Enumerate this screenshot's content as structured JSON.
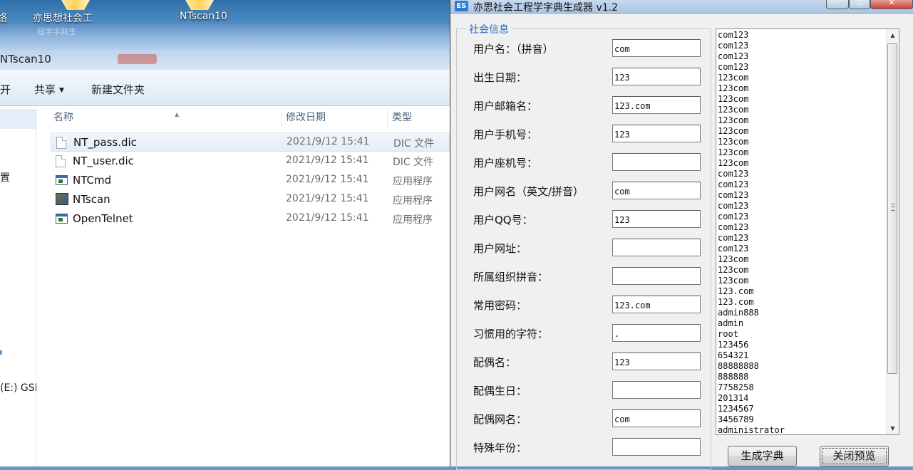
{
  "desktop": {
    "icons": [
      {
        "label": "络",
        "glyph": "partial-icon"
      },
      {
        "label": "亦思想社会工",
        "sub": "程学字典生",
        "glyph": "folder-icon"
      },
      {
        "label": "NTscan10",
        "glyph": "folder-icon"
      }
    ]
  },
  "explorer": {
    "address": "NTscan10",
    "toolbar": {
      "open": "开",
      "share": "共享",
      "new_folder": "新建文件夹"
    },
    "nav": {
      "item_settings": "置",
      "item_drive": "(E:) GSP"
    },
    "columns": {
      "name": "名称",
      "date": "修改日期",
      "type": "类型"
    },
    "files": [
      {
        "name": "NT_pass.dic",
        "date": "2021/9/12 15:41",
        "type": "DIC 文件",
        "icon": "document-icon"
      },
      {
        "name": "NT_user.dic",
        "date": "2021/9/12 15:41",
        "type": "DIC 文件",
        "icon": "document-icon"
      },
      {
        "name": "NTCmd",
        "date": "2021/9/12 15:41",
        "type": "应用程序",
        "icon": "application-icon"
      },
      {
        "name": "NTscan",
        "date": "2021/9/12 15:41",
        "type": "应用程序",
        "icon": "ntscan-app-icon"
      },
      {
        "name": "OpenTelnet",
        "date": "2021/9/12 15:41",
        "type": "应用程序",
        "icon": "application-icon"
      }
    ]
  },
  "generator": {
    "app_icon_text": "ES",
    "title": "亦思社会工程学字典生成器 v1.2",
    "group_title": "社会信息",
    "fields": [
      {
        "label": "用户名：（拼音）",
        "value": "com"
      },
      {
        "label": "出生日期：",
        "value": "123"
      },
      {
        "label": "用户邮箱名：",
        "value": "123.com"
      },
      {
        "label": "用户手机号：",
        "value": "123"
      },
      {
        "label": "用户座机号：",
        "value": ""
      },
      {
        "label": "用户网名（英文/拼音）",
        "value": "com"
      },
      {
        "label": "用户QQ号：",
        "value": "123"
      },
      {
        "label": "用户网址：",
        "value": ""
      },
      {
        "label": "所属组织拼音：",
        "value": ""
      },
      {
        "label": "常用密码：",
        "value": "123.com"
      },
      {
        "label": "习惯用的字符：",
        "value": "."
      },
      {
        "label": "配偶名：",
        "value": "123"
      },
      {
        "label": "配偶生日：",
        "value": ""
      },
      {
        "label": "配偶网名：",
        "value": "com"
      },
      {
        "label": "特殊年份：",
        "value": ""
      }
    ],
    "preview_lines": [
      "com123",
      "com123",
      "com123",
      "com123",
      "123com",
      "123com",
      "123com",
      "123com",
      "123com",
      "123com",
      "123com",
      "123com",
      "123com",
      "com123",
      "com123",
      "com123",
      "com123",
      "com123",
      "com123",
      "com123",
      "com123",
      "123com",
      "123com",
      "123com",
      "123.com",
      "123.com",
      "admin888",
      "admin",
      "root",
      "123456",
      "654321",
      "88888888",
      "888888",
      "7758258",
      "201314",
      "1234567",
      "3456789",
      "administrator"
    ],
    "buttons": {
      "generate": "生成字典",
      "close_preview": "关闭预览"
    }
  }
}
